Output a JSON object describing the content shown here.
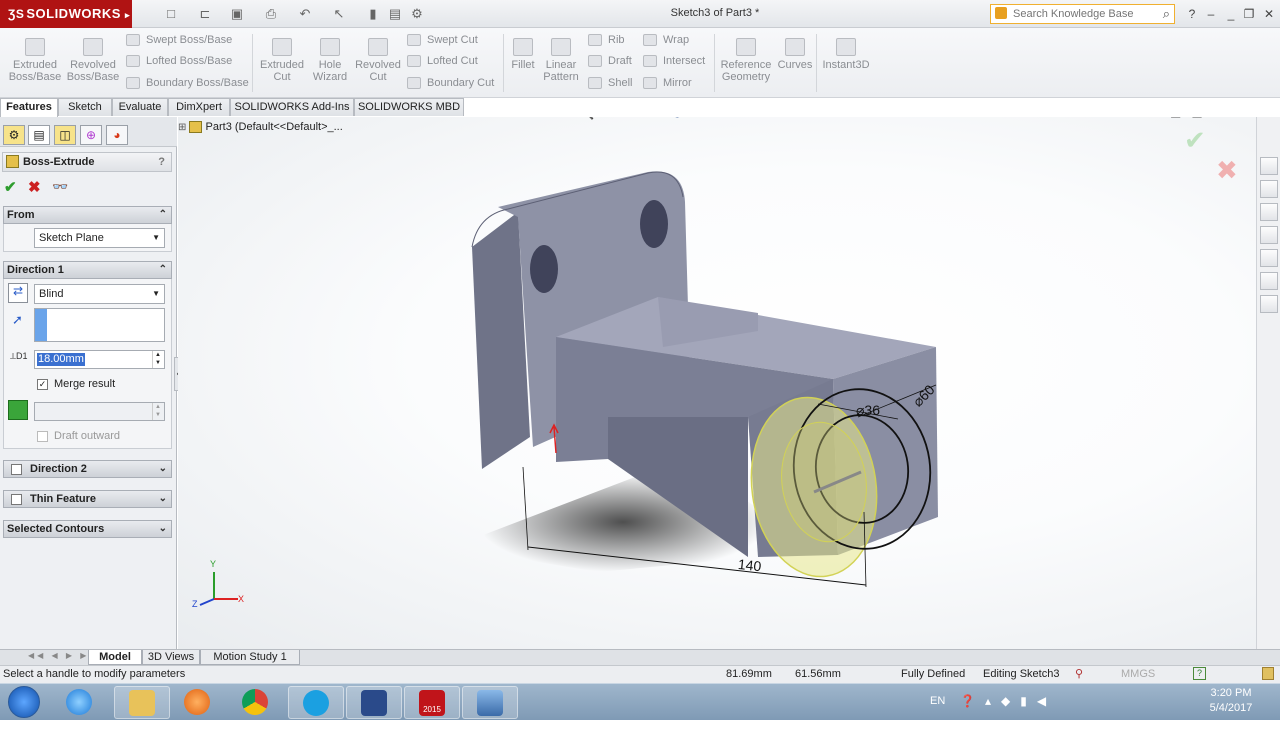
{
  "app": {
    "brand": "SOLIDWORKS",
    "doc_title": "Sketch3 of Part3 *"
  },
  "search": {
    "placeholder": "Search Knowledge Base"
  },
  "commands": {
    "extruded_boss": [
      "Extruded",
      "Boss/Base"
    ],
    "revolved_boss": [
      "Revolved",
      "Boss/Base"
    ],
    "swept_boss": "Swept Boss/Base",
    "lofted_boss": "Lofted Boss/Base",
    "boundary_boss": "Boundary Boss/Base",
    "extruded_cut": [
      "Extruded",
      "Cut"
    ],
    "hole_wizard": [
      "Hole",
      "Wizard"
    ],
    "revolved_cut": [
      "Revolved",
      "Cut"
    ],
    "swept_cut": "Swept Cut",
    "lofted_cut": "Lofted Cut",
    "boundary_cut": "Boundary Cut",
    "fillet": "Fillet",
    "linear_pattern": [
      "Linear",
      "Pattern"
    ],
    "rib": "Rib",
    "draft": "Draft",
    "shell": "Shell",
    "wrap": "Wrap",
    "intersect": "Intersect",
    "mirror": "Mirror",
    "reference_geometry": [
      "Reference",
      "Geometry"
    ],
    "curves": "Curves",
    "instant3d": "Instant3D"
  },
  "tabs": [
    "Features",
    "Sketch",
    "Evaluate",
    "DimXpert",
    "SOLIDWORKS Add-Ins",
    "SOLIDWORKS MBD"
  ],
  "tree": {
    "root": "Part3  (Default<<Default>_..."
  },
  "property_manager": {
    "title": "Boss-Extrude",
    "help": "?",
    "from_label": "From",
    "from_value": "Sketch Plane",
    "direction1_label": "Direction 1",
    "end_condition": "Blind",
    "depth": "18.00mm",
    "depth_prefix": "D1",
    "merge_result": "Merge result",
    "draft_outward": "Draft outward",
    "direction2_label": "Direction 2",
    "thin_feature_label": "Thin Feature",
    "selected_contours_label": "Selected Contours"
  },
  "dimensions": {
    "d_large": "⌀60",
    "d_small": "⌀36",
    "length": "140"
  },
  "triad": {
    "x": "X",
    "y": "Y",
    "z": "Z"
  },
  "bottom_tabs": [
    "Model",
    "3D Views",
    "Motion Study 1"
  ],
  "status": {
    "message": "Select a handle to modify parameters",
    "x": "81.69mm",
    "y": "61.56mm",
    "state": "Fully Defined",
    "editing": "Editing Sketch3",
    "units": "MMGS",
    "help": "?"
  },
  "taskbar": {
    "lang": "EN",
    "time": "3:20 PM",
    "date": "5/4/2017",
    "sw_badge": "2015"
  },
  "colors": {
    "brand": "#b01313",
    "accent_ok": "#2e9d2e",
    "cancel": "#cc2222",
    "part": "#8e92a6",
    "preview": "#e8e88c"
  }
}
